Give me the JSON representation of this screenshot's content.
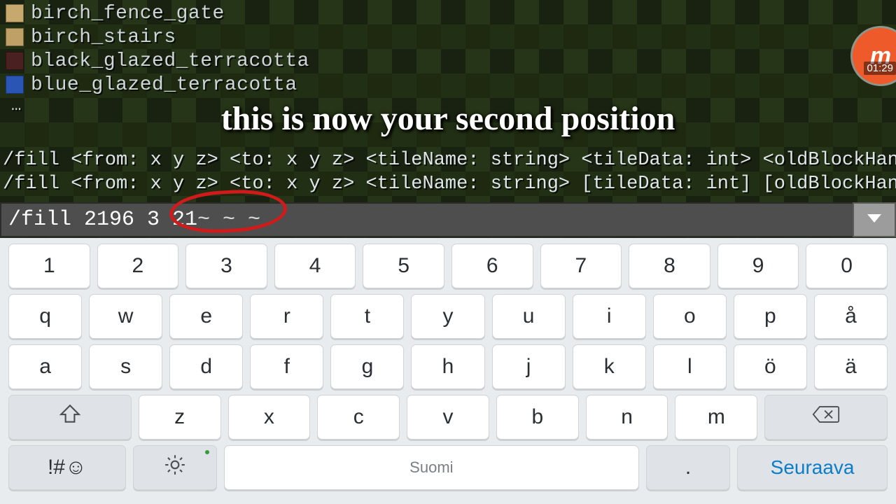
{
  "suggestions": [
    {
      "label": "birch_fence_gate",
      "iconColor": "#c7a96d"
    },
    {
      "label": "birch_stairs",
      "iconColor": "#bfa066"
    },
    {
      "label": "black_glazed_terracotta",
      "iconColor": "#4a2020"
    },
    {
      "label": "blue_glazed_terracotta",
      "iconColor": "#2b55b5"
    }
  ],
  "ellipsis": "…",
  "caption": "this is now your second position",
  "syntax_line1": "/fill <from: x y z> <to: x y z> <tileName: string> <tileData: int> <oldBlockHandli",
  "syntax_line2": "/fill <from: x y z> <to: x y z> <tileName: string> [tileData: int] [oldBlockHandli",
  "command_input_left": "/fill 2196 3 21",
  "command_input_tildes": " ~ ~ ~",
  "recorder": {
    "badge": "m",
    "time": "01:29"
  },
  "keyboard": {
    "row_num": [
      "1",
      "2",
      "3",
      "4",
      "5",
      "6",
      "7",
      "8",
      "9",
      "0"
    ],
    "row_q": [
      "q",
      "w",
      "e",
      "r",
      "t",
      "y",
      "u",
      "i",
      "o",
      "p",
      "å"
    ],
    "row_a": [
      "a",
      "s",
      "d",
      "f",
      "g",
      "h",
      "j",
      "k",
      "l",
      "ö",
      "ä"
    ],
    "row_z": [
      "z",
      "x",
      "c",
      "v",
      "b",
      "n",
      "m"
    ],
    "sym_label": "!#☺",
    "space_label": "Suomi",
    "period_label": ".",
    "next_label": "Seuraava"
  }
}
